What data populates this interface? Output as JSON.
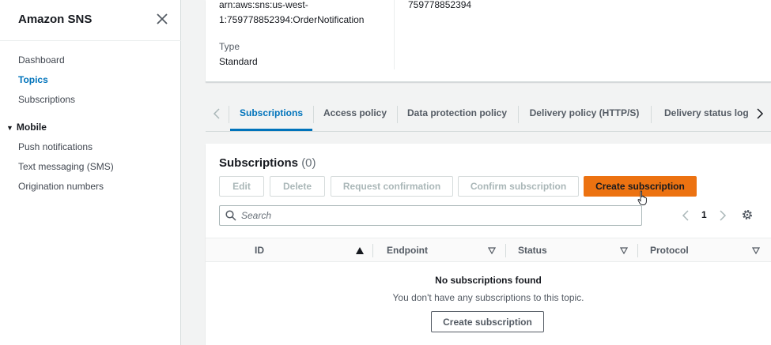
{
  "sidebar": {
    "title": "Amazon SNS",
    "links": {
      "dashboard": "Dashboard",
      "topics": "Topics",
      "subscriptions": "Subscriptions"
    },
    "mobile_section": "Mobile",
    "mobile_links": {
      "push": "Push notifications",
      "sms": "Text messaging (SMS)",
      "origination": "Origination numbers"
    }
  },
  "details": {
    "arn_line1": "arn:aws:sns:us-west-",
    "arn_line2": "1:759778852394:OrderNotification",
    "type_label": "Type",
    "type_value": "Standard",
    "account_id": "759778852394"
  },
  "tabs": {
    "subscriptions": "Subscriptions",
    "access_policy": "Access policy",
    "data_protection": "Data protection policy",
    "delivery_policy": "Delivery policy (HTTP/S)",
    "delivery_status": "Delivery status loggi"
  },
  "subscriptions_panel": {
    "title": "Subscriptions",
    "count": "(0)",
    "buttons": {
      "edit": "Edit",
      "delete": "Delete",
      "request_confirmation": "Request confirmation",
      "confirm_subscription": "Confirm subscription",
      "create_subscription": "Create subscription"
    },
    "search_placeholder": "Search",
    "current_page": "1",
    "columns": {
      "id": "ID",
      "endpoint": "Endpoint",
      "status": "Status",
      "protocol": "Protocol"
    },
    "empty_title": "No subscriptions found",
    "empty_description": "You don't have any subscriptions to this topic.",
    "empty_create_button": "Create subscription"
  },
  "colors": {
    "primary_orange": "#ec7211",
    "link_blue": "#0073bb",
    "text_dark": "#16191f",
    "background": "#f2f3f3"
  }
}
